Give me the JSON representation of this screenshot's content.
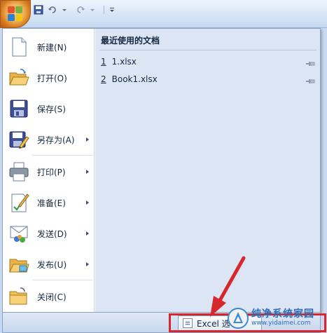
{
  "quick_access": {
    "items": [
      "save-icon",
      "undo-icon",
      "redo-icon",
      "customize-icon"
    ]
  },
  "menu": {
    "items": [
      {
        "label": "新建(N)",
        "icon": "new-document-icon",
        "submenu": false
      },
      {
        "label": "打开(O)",
        "icon": "open-folder-icon",
        "submenu": false
      },
      {
        "label": "保存(S)",
        "icon": "save-disk-icon",
        "submenu": false
      },
      {
        "label": "另存为(A)",
        "icon": "save-as-icon",
        "submenu": true
      },
      {
        "label": "打印(P)",
        "icon": "printer-icon",
        "submenu": true
      },
      {
        "label": "准备(E)",
        "icon": "prepare-icon",
        "submenu": true
      },
      {
        "label": "发送(D)",
        "icon": "send-icon",
        "submenu": true
      },
      {
        "label": "发布(U)",
        "icon": "publish-icon",
        "submenu": true
      },
      {
        "label": "关闭(C)",
        "icon": "close-folder-icon",
        "submenu": false
      }
    ]
  },
  "recent": {
    "title": "最近使用的文档",
    "files": [
      {
        "num": "1",
        "name": "1.xlsx"
      },
      {
        "num": "2",
        "name": "Book1.xlsx"
      }
    ]
  },
  "footer": {
    "excel_options_label": "Excel 选"
  },
  "watermark": {
    "name": "纯净系统家园",
    "url": "www.yidaimei.com"
  },
  "colors": {
    "highlight_red": "#d7262c",
    "panel_blue": "#dbe5f4"
  }
}
